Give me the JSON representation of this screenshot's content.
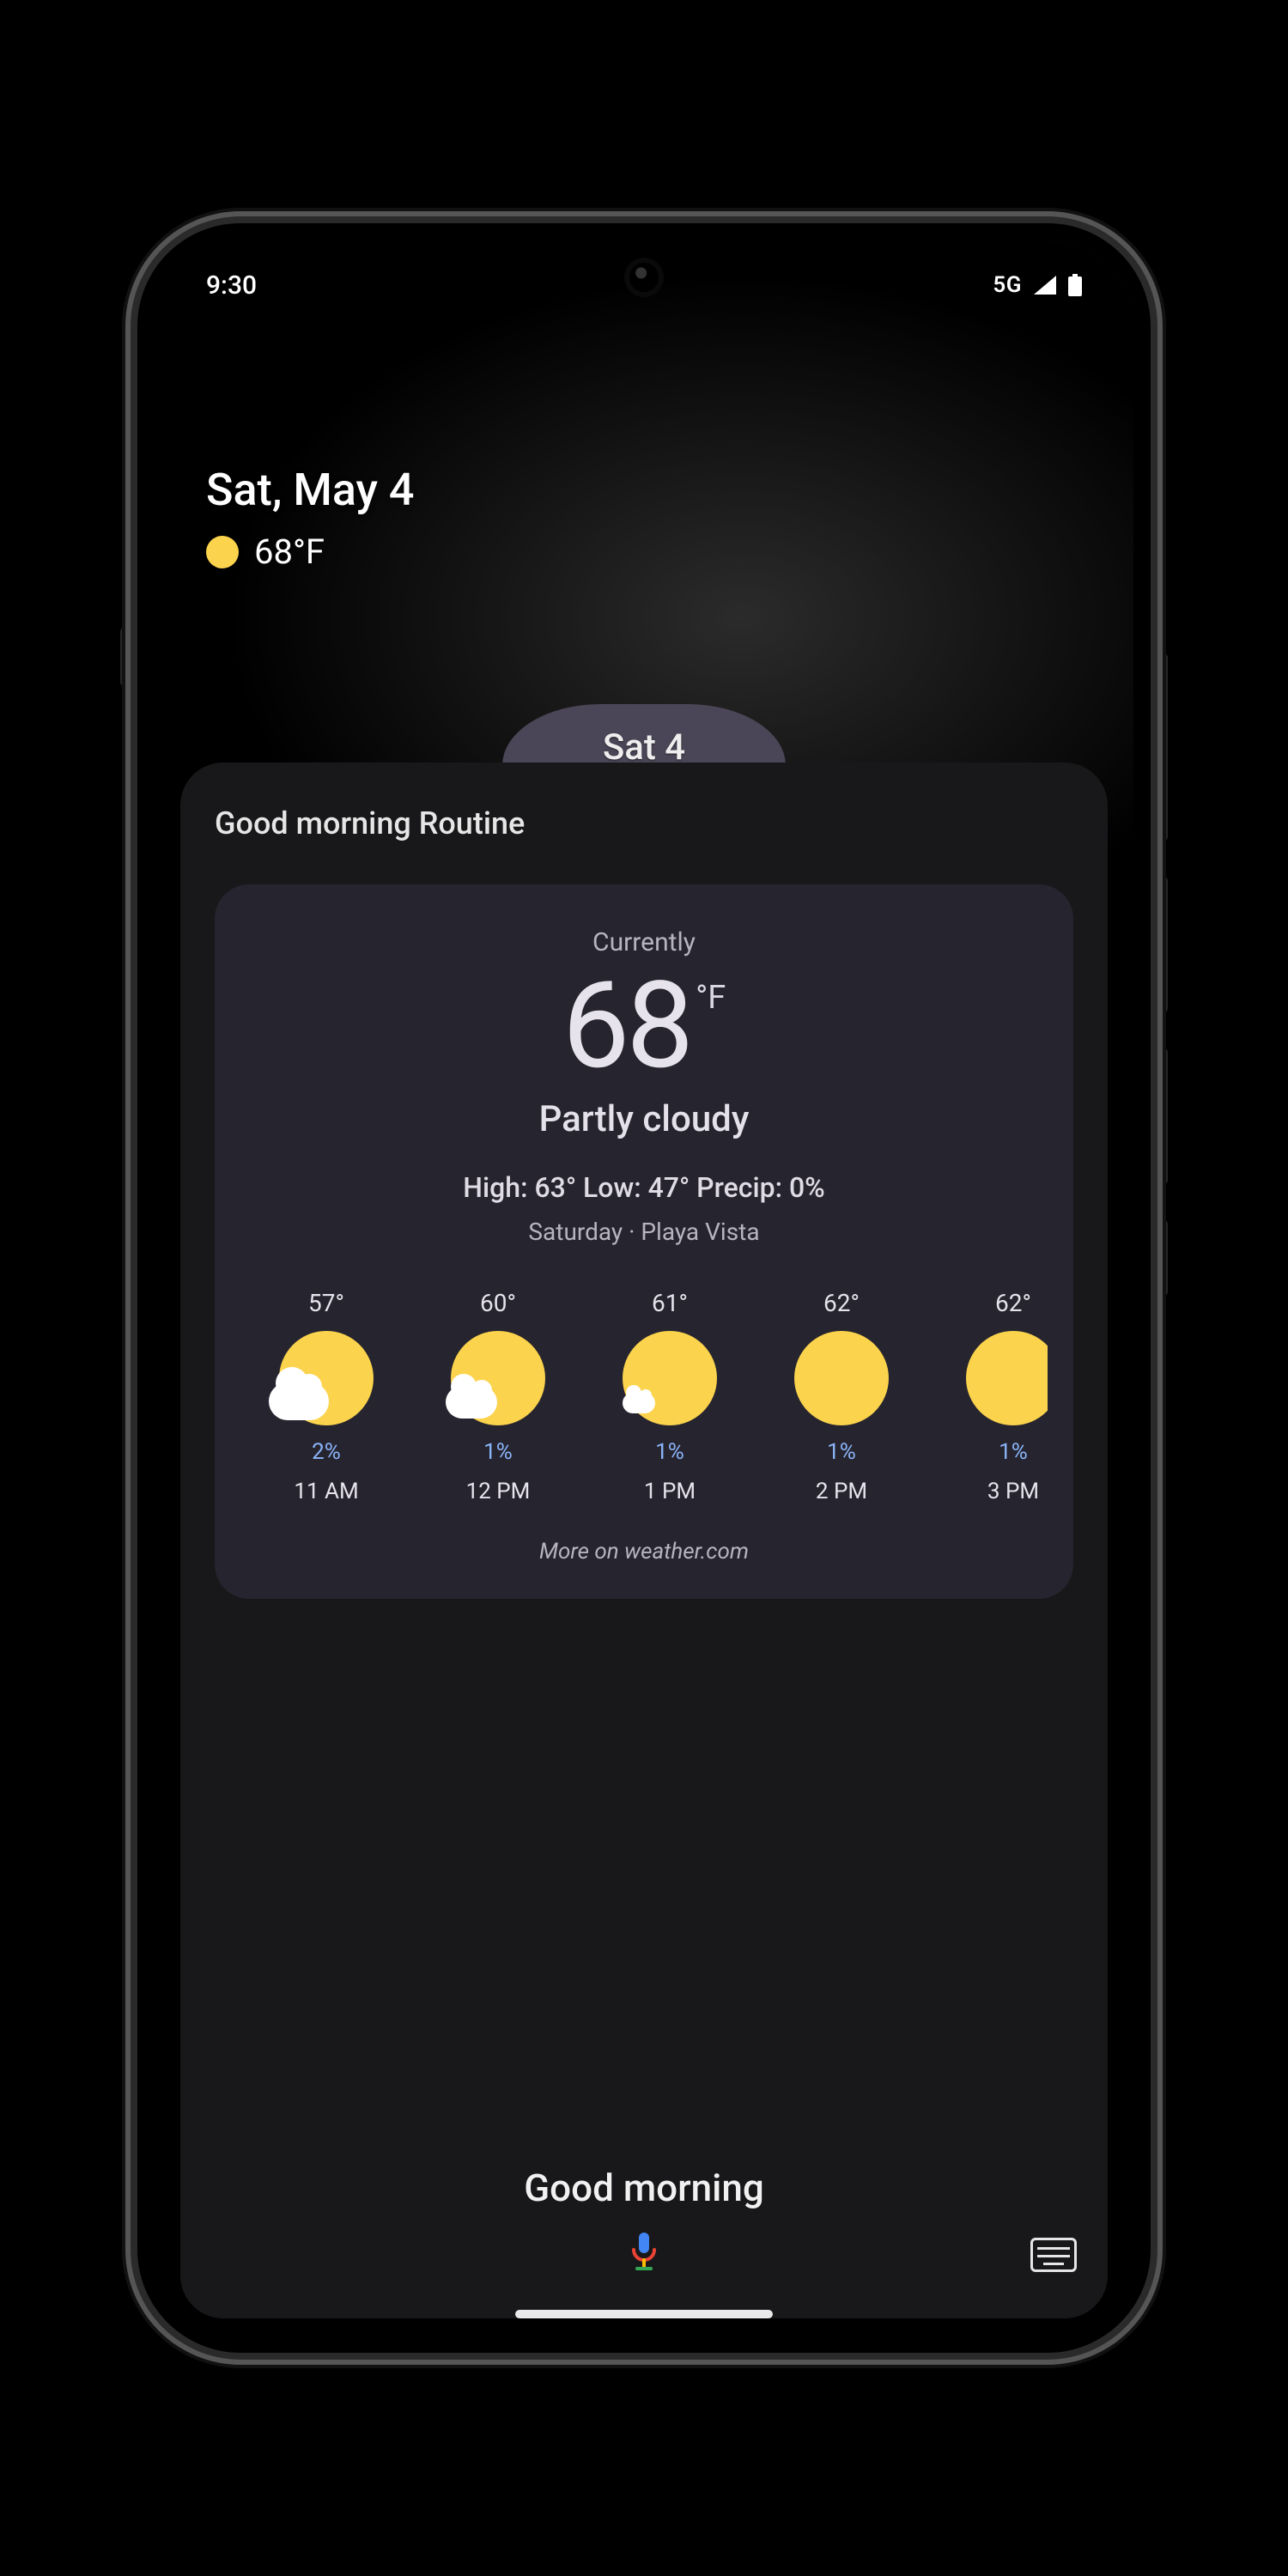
{
  "statusbar": {
    "time": "9:30",
    "network": "5G"
  },
  "ambient": {
    "date": "Sat, May 4",
    "temp": "68°F"
  },
  "blob": {
    "label": "Sat 4"
  },
  "sheet": {
    "title": "Good morning Routine"
  },
  "weather": {
    "label_now": "Currently",
    "temp": "68",
    "unit": "°F",
    "condition": "Partly cloudy",
    "highlow": "High: 63° Low: 47°  Precip: 0%",
    "dayloc": "Saturday · Playa Vista",
    "more": "More on weather.com"
  },
  "hourly": [
    {
      "temp": "57°",
      "cloud": "big",
      "precip": "2%",
      "time": "11 AM"
    },
    {
      "temp": "60°",
      "cloud": "mid",
      "precip": "1%",
      "time": "12 PM"
    },
    {
      "temp": "61°",
      "cloud": "sm",
      "precip": "1%",
      "time": "1 PM"
    },
    {
      "temp": "62°",
      "cloud": "none",
      "precip": "1%",
      "time": "2 PM"
    },
    {
      "temp": "62°",
      "cloud": "none",
      "precip": "1%",
      "time": "3 PM"
    }
  ],
  "assistant": {
    "greeting": "Good morning"
  }
}
